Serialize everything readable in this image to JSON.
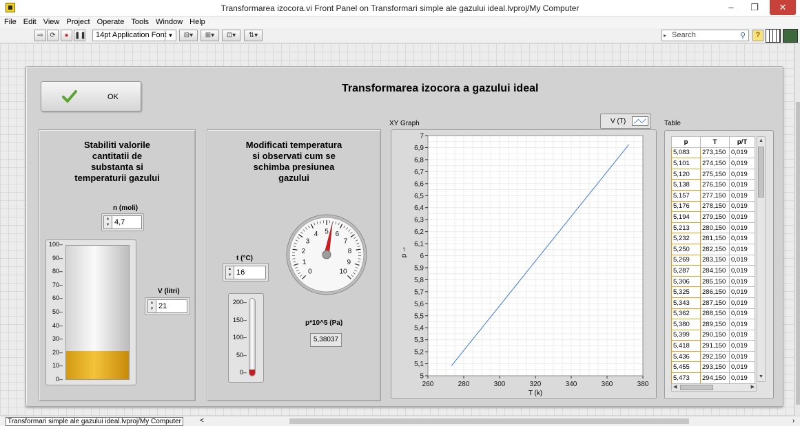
{
  "window": {
    "title": "Transformarea izocora.vi Front Panel on Transformari simple ale gazului ideal.lvproj/My Computer",
    "minimize": "–",
    "maximize": "❐",
    "close": "✕"
  },
  "menu": [
    "File",
    "Edit",
    "View",
    "Project",
    "Operate",
    "Tools",
    "Window",
    "Help"
  ],
  "toolbar": {
    "font": "14pt Application Font",
    "search_placeholder": "Search",
    "help": "?"
  },
  "panel": {
    "ok_label": "OK",
    "title": "Transformarea izocora a gazului ideal"
  },
  "left_box": {
    "title_lines": [
      "Stabiliti valorile",
      "cantitatii de",
      "substanta si",
      "temperaturii gazului"
    ],
    "n_label": "n (moli)",
    "n_value": "4,7",
    "v_label": "V (litri)",
    "v_value": "21",
    "tank_level": 21,
    "tank_ticks": [
      "100",
      "90",
      "80",
      "70",
      "60",
      "50",
      "40",
      "30",
      "20",
      "10",
      "0"
    ]
  },
  "mid_box": {
    "title_lines": [
      "Modificati temperatura",
      "si observati cum se",
      "schimba presiunea",
      "gazului"
    ],
    "gauge_ticks": [
      "0",
      "1",
      "2",
      "3",
      "4",
      "5",
      "6",
      "7",
      "8",
      "9",
      "10"
    ],
    "gauge_value": 5.38,
    "t_label": "t (°C)",
    "t_value": "16",
    "thermo_ticks": [
      "200",
      "150",
      "100",
      "50",
      "0"
    ],
    "thermo_level": 16,
    "p_label": "p*10^5 (Pa)",
    "p_value": "5,38037"
  },
  "graph": {
    "label": "XY Graph",
    "legend_name": "V (T)",
    "chart_data": {
      "type": "line",
      "xlabel": "T (k)",
      "ylabel": "p",
      "xlim": [
        260,
        380
      ],
      "ylim": [
        5,
        7
      ],
      "x_ticks": [
        "260",
        "280",
        "300",
        "320",
        "340",
        "360",
        "380"
      ],
      "y_ticks": [
        "5",
        "5,1",
        "5,2",
        "5,3",
        "5,4",
        "5,5",
        "5,6",
        "5,7",
        "5,8",
        "5,9",
        "6",
        "6,1",
        "6,2",
        "6,3",
        "6,4",
        "6,5",
        "6,6",
        "6,7",
        "6,8",
        "6,9",
        "7"
      ],
      "grid": true,
      "series": [
        {
          "name": "V (T)",
          "color": "#3b7bd4",
          "x": [
            273.15,
            372.15
          ],
          "y": [
            5.083,
            6.925
          ]
        }
      ]
    }
  },
  "table": {
    "label": "Table",
    "headers": [
      "p",
      "T",
      "p/T"
    ],
    "rows": [
      [
        "5,083",
        "273,150",
        "0,019"
      ],
      [
        "5,101",
        "274,150",
        "0,019"
      ],
      [
        "5,120",
        "275,150",
        "0,019"
      ],
      [
        "5,138",
        "276,150",
        "0,019"
      ],
      [
        "5,157",
        "277,150",
        "0,019"
      ],
      [
        "5,176",
        "278,150",
        "0,019"
      ],
      [
        "5,194",
        "279,150",
        "0,019"
      ],
      [
        "5,213",
        "280,150",
        "0,019"
      ],
      [
        "5,232",
        "281,150",
        "0,019"
      ],
      [
        "5,250",
        "282,150",
        "0,019"
      ],
      [
        "5,269",
        "283,150",
        "0,019"
      ],
      [
        "5,287",
        "284,150",
        "0,019"
      ],
      [
        "5,306",
        "285,150",
        "0,019"
      ],
      [
        "5,325",
        "286,150",
        "0,019"
      ],
      [
        "5,343",
        "287,150",
        "0,019"
      ],
      [
        "5,362",
        "288,150",
        "0,019"
      ],
      [
        "5,380",
        "289,150",
        "0,019"
      ],
      [
        "5,399",
        "290,150",
        "0,019"
      ],
      [
        "5,418",
        "291,150",
        "0,019"
      ],
      [
        "5,436",
        "292,150",
        "0,019"
      ],
      [
        "5,455",
        "293,150",
        "0,019"
      ],
      [
        "5,473",
        "294,150",
        "0,019"
      ]
    ]
  },
  "status": {
    "path": "Transformari simple ale gazului ideal.lvproj/My Computer",
    "arrow": "<"
  }
}
